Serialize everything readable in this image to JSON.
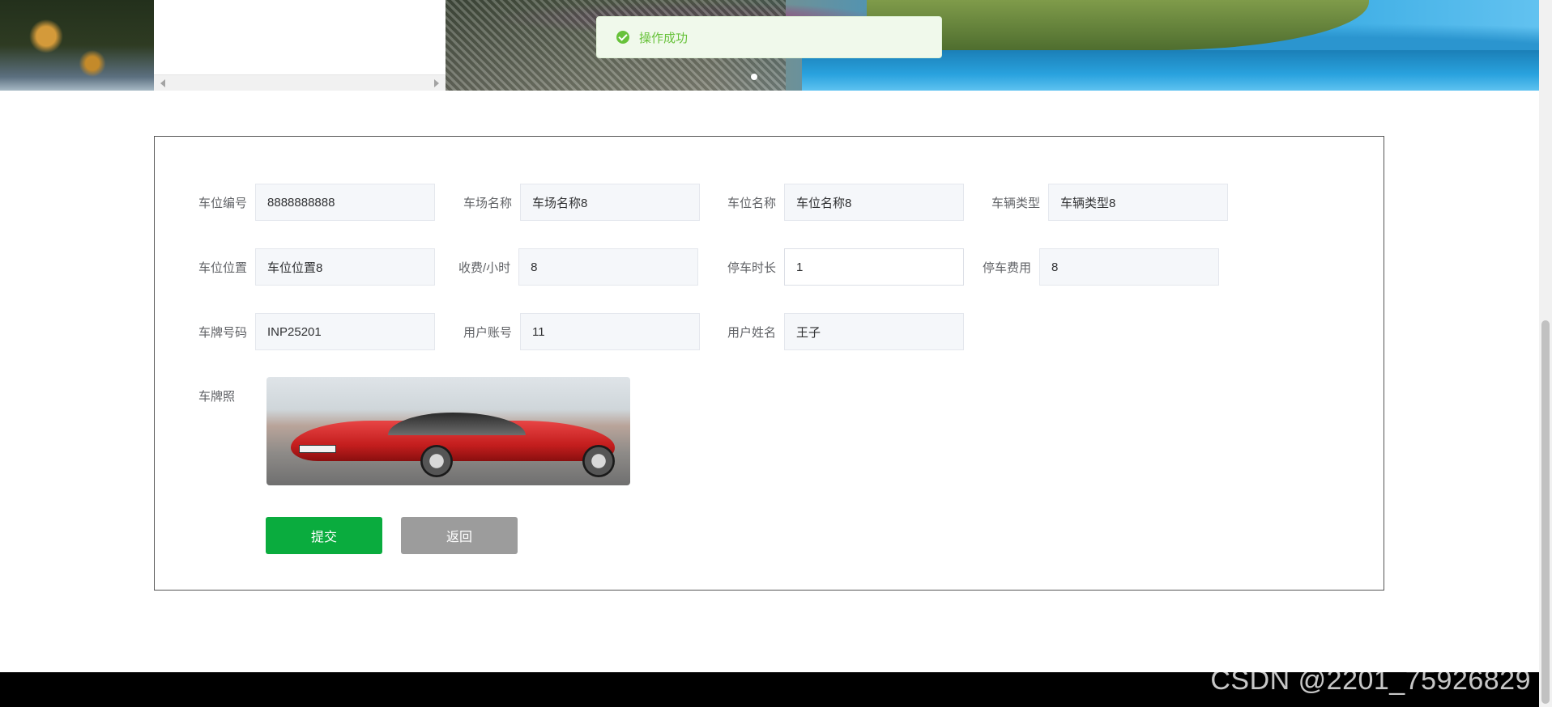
{
  "toast": {
    "message": "操作成功",
    "icon": "check-circle-icon",
    "color": "#67c23a"
  },
  "form": {
    "fields": {
      "space_no": {
        "label": "车位编号",
        "value": "8888888888"
      },
      "lot_name": {
        "label": "车场名称",
        "value": "车场名称8"
      },
      "space_name": {
        "label": "车位名称",
        "value": "车位名称8"
      },
      "vehicle_type": {
        "label": "车辆类型",
        "value": "车辆类型8"
      },
      "space_location": {
        "label": "车位位置",
        "value": "车位位置8"
      },
      "fee_per_hour": {
        "label": "收费/小时",
        "value": "8"
      },
      "parking_duration": {
        "label": "停车时长",
        "value": "1"
      },
      "parking_fee": {
        "label": "停车费用",
        "value": "8"
      },
      "plate_no": {
        "label": "车牌号码",
        "value": "INP25201"
      },
      "user_account": {
        "label": "用户账号",
        "value": "11"
      },
      "user_name": {
        "label": "用户姓名",
        "value": "王子"
      }
    },
    "photo_label": "车牌照",
    "submit_label": "提交",
    "back_label": "返回",
    "submit_color": "#0aac3e",
    "back_color": "#9c9c9c"
  },
  "watermark": "CSDN @2201_75926829"
}
